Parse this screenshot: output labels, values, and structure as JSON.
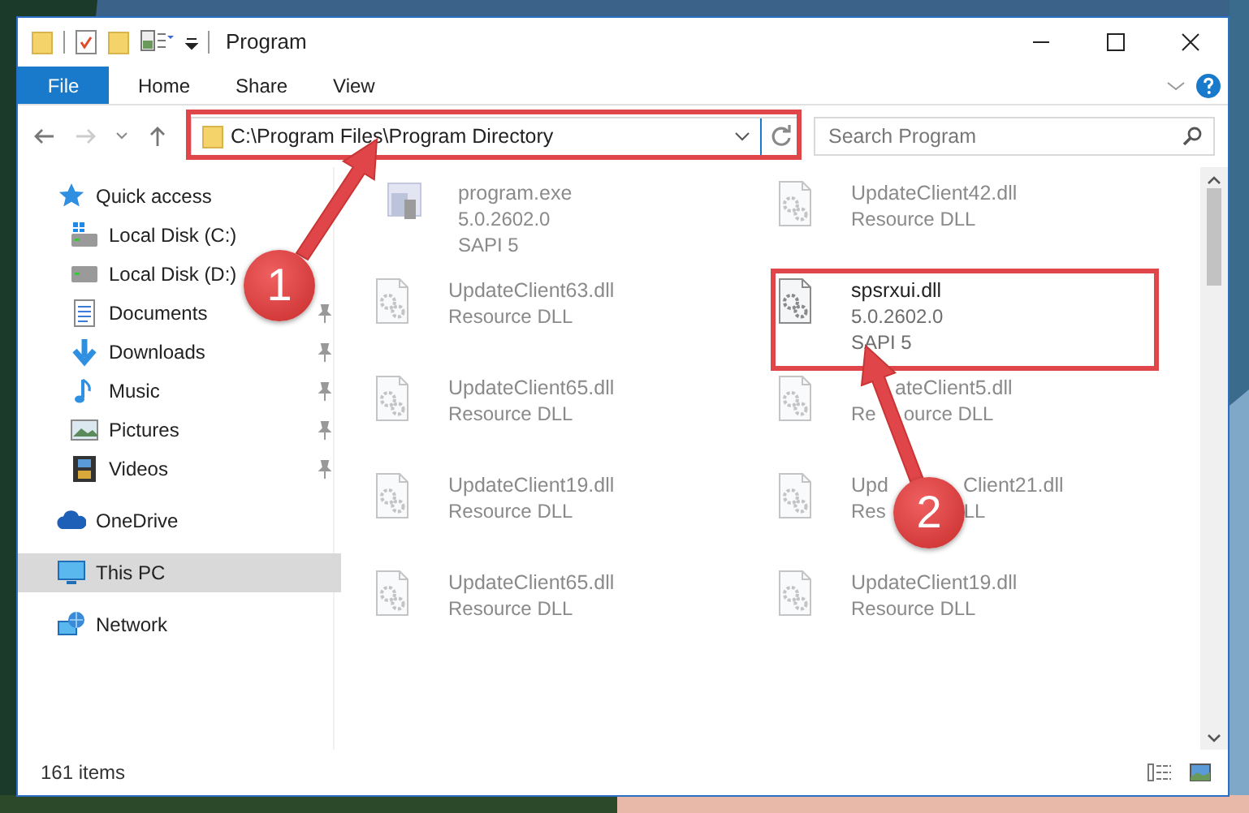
{
  "window": {
    "title": "Program"
  },
  "ribbon": {
    "tabs": [
      {
        "label": "File",
        "kind": "file",
        "selected": false
      },
      {
        "label": "Home",
        "kind": "tab",
        "selected": false
      },
      {
        "label": "Share",
        "kind": "tab",
        "selected": false
      },
      {
        "label": "View",
        "kind": "tab",
        "selected": false
      }
    ]
  },
  "address": {
    "path": "C:\\Program Files\\Program Directory",
    "highlighted": true
  },
  "search": {
    "placeholder": "Search Program"
  },
  "nav": [
    {
      "label": "Quick access",
      "kind": "star",
      "selected": false,
      "children": [
        {
          "label": "Local Disk (C:)",
          "kind": "drive-c",
          "selected": false
        },
        {
          "label": "Local Disk (D:)",
          "kind": "drive",
          "selected": false
        },
        {
          "label": "Documents",
          "kind": "documents",
          "pinned": true,
          "selected": false
        },
        {
          "label": "Downloads",
          "kind": "downloads",
          "pinned": true,
          "selected": false
        },
        {
          "label": "Music",
          "kind": "music",
          "pinned": true,
          "selected": false
        },
        {
          "label": "Pictures",
          "kind": "pictures",
          "pinned": true,
          "selected": false
        },
        {
          "label": "Videos",
          "kind": "videos",
          "pinned": true,
          "selected": false
        }
      ]
    },
    {
      "label": "OneDrive",
      "kind": "cloud",
      "selected": false
    },
    {
      "label": "This PC",
      "kind": "pc",
      "selected": true
    },
    {
      "label": "Network",
      "kind": "network",
      "selected": false
    }
  ],
  "files": [
    {
      "name": "program.exe",
      "lines": [
        "5.0.2602.0",
        "SAPI 5"
      ],
      "kind": "exe",
      "blurred": true,
      "highlighted": false
    },
    {
      "name": "UpdateClient42.dll",
      "lines": [
        "Resource DLL"
      ],
      "kind": "dll",
      "blurred": true,
      "highlighted": false
    },
    {
      "name": "UpdateClient63.dll",
      "lines": [
        "Resource DLL"
      ],
      "kind": "dll",
      "blurred": true,
      "highlighted": false
    },
    {
      "name": "spsrxui.dll",
      "lines": [
        "5.0.2602.0",
        "SAPI 5"
      ],
      "kind": "dll",
      "blurred": false,
      "highlighted": true
    },
    {
      "name": "UpdateClient65.dll",
      "lines": [
        "Resource DLL"
      ],
      "kind": "dll",
      "blurred": true,
      "highlighted": false
    },
    {
      "name": [
        "ateClient5.dll"
      ],
      "lines": [
        [
          "Re",
          "ource DLL"
        ]
      ],
      "kind": "dll",
      "blurred": true,
      "highlighted": false
    },
    {
      "name": "UpdateClient19.dll",
      "lines": [
        "Resource DLL"
      ],
      "kind": "dll",
      "blurred": true,
      "highlighted": false
    },
    {
      "name": [
        "Upd",
        "Client21.dll"
      ],
      "lines": [
        [
          "Res",
          "LL"
        ]
      ],
      "kind": "dll",
      "blurred": true,
      "highlighted": false
    },
    {
      "name": "UpdateClient65.dll",
      "lines": [
        "Resource DLL"
      ],
      "kind": "dll",
      "blurred": true,
      "highlighted": false
    },
    {
      "name": "UpdateClient19.dll",
      "lines": [
        "Resource DLL"
      ],
      "kind": "dll",
      "blurred": true,
      "highlighted": false
    }
  ],
  "annotations": [
    {
      "label": "1"
    },
    {
      "label": "2"
    }
  ],
  "status_bar": {
    "count": "161 items"
  }
}
